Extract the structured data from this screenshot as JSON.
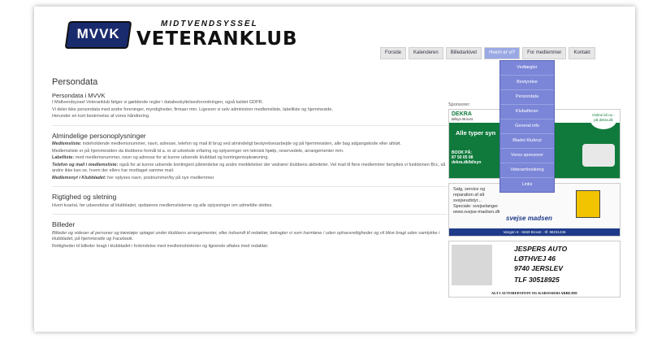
{
  "header": {
    "logo_badge": "MVVK",
    "logo_small": "MIDTVENDSYSSEL",
    "logo_big": "VETERANKLUB"
  },
  "nav": {
    "items": [
      "Forside",
      "Kalenderen",
      "Billedarkivet",
      "Hvem er vi?",
      "For medlemmer",
      "Kontakt"
    ],
    "active_index": 3
  },
  "dropdown": {
    "items": [
      "Vedtægter",
      "Bestyrelse",
      "Persondata",
      "Klubaftener",
      "General info",
      "Bladet Klubnyt",
      "Vores sponsorer",
      "Veteranforsikring",
      "Links"
    ]
  },
  "main": {
    "title": "Persondata",
    "s1_heading": "Persondata i MVVK",
    "s1_p1": "I Midtvendsyssel Veteranklub følger vi gældende regler i databeskyttelsesforordningen, også kaldet GDPR.",
    "s1_p2": "Vi deler ikke persondata med andre foreninger, myndigheder, firmaer mm. Ligesom vi selv administrer medlemsliste, labelliste og hjemmeside.",
    "s1_p3": "Herunder en kort beskrivelse af vores håndtering.",
    "s2_heading": "Almindelige personoplysninger",
    "s2_p1_label": "Medlemsliste:",
    "s2_p1": "indeholdende medlemsnummer, navn, adresse, telefon og mail til brug ved almindeligt bestyrelsesarbejde og på hjemmesiden, alle bag adgangskode eller afsløt.",
    "s2_p2": "Medlemsliste er på hjemmesiden da klubbens formål bl.a. er at udveksle erfaring og oplysninger om teknisk hjælp, reservedele, arrangementer mm.",
    "s2_p3_label": "Labelliste:",
    "s2_p3": "med medlemsnummer, navn og adresse for at kunne udsende klubblad og kontingentopkrævning.",
    "s2_p4_label": "Telefon og mail i medlemsliste:",
    "s2_p4": "også for at kunne udsende kontingent påmindelse og andre meddelelser der vedrører klubbens aktiviteter. Vel mail til flere medlemmer benyttes vi funktionen Bcc, så andre ikke kan se, hvem der ellers har modtaget samme mail.",
    "s2_p5_label": "Medlemsnyt i Klubbladet:",
    "s2_p5": "her oplyses navn, postnummer/by på nye medlemmer.",
    "s3_heading": "Rigtighed og sletning",
    "s3_p1": "Hvert kvartal, før udsendelse af klubbladet, opdateres medlemslisterne og alle oplysninger om udmeldte slettes.",
    "s4_heading": "Billeder",
    "s4_p1": "Billeder og videoer af personer og køretøjer optaget under klubbens arrangementer, eller indsendt til redaktør, betragter vi som harmløse / uden ophavsrettigheder og vil blive bragt uden samtykke i klubbladet, på hjemmeside og Facebook.",
    "s4_p2": "Rettigheder til billeder bragt i klubbladet i forbindelse med medlemshistorier og lignende aftales med redaktør."
  },
  "sidebar": {
    "title": "Sponsorer:",
    "dekra": {
      "brand": "DEKRA",
      "sub": "Bilsyn Brovst",
      "tagline": "Alle typer syn",
      "book": [
        "BOOK PÅ:",
        "87 50 05 08",
        "dekra.dk/bilsyn"
      ],
      "bubble": "Online bil nu - på dekra.dk"
    },
    "svejse": {
      "lines": [
        "Salg, service og",
        "reparation af alt",
        "svejseudstyr...",
        "Speciale: svejselanger"
      ],
      "url": "www.svejse-madsen.dk",
      "logo": "svejse madsen",
      "address": "Vangen 6 - 9460 Brovst - tlf. 98231436"
    },
    "jesper": {
      "lines": [
        "JESPERS AUTO",
        "LØTHVEJ 46",
        "9740 JERSLEV",
        "TLF 30518925"
      ],
      "footer": "ALT I AUTOREPATION OG KAROSSERI ARBEJDE"
    }
  }
}
